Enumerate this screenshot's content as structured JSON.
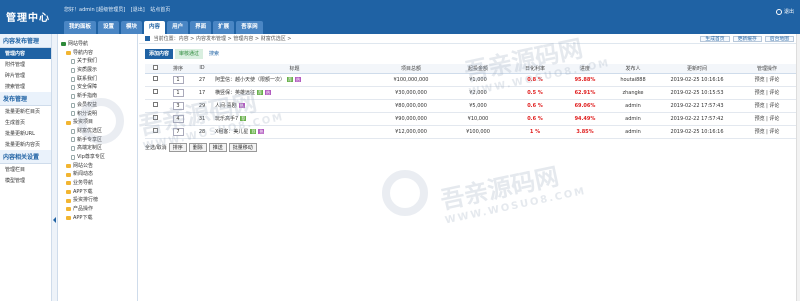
{
  "header": {
    "brand": "管理中心",
    "userbar": [
      "您好！admin [超级管理员]",
      "[退出]",
      "站点首页"
    ],
    "tabs": [
      "我的面板",
      "设置",
      "模块",
      "内容",
      "用户",
      "界面",
      "扩展",
      "吾享网"
    ],
    "active_tab": 3,
    "exit": "退出"
  },
  "left": {
    "sections": [
      {
        "title": "内容发布管理",
        "items": [
          "管理内容",
          "附件管理",
          "碎片管理",
          "搜索管理"
        ],
        "active": 0
      },
      {
        "title": "发布管理",
        "items": [
          "批量更新栏目页",
          "生成首页",
          "批量更新URL",
          "批量更新内容页"
        ]
      },
      {
        "title": "内容相关设置",
        "items": [
          "管理栏目",
          "模型管理"
        ]
      }
    ]
  },
  "tree": [
    {
      "label": "网站导航",
      "depth": 0,
      "icon": "check"
    },
    {
      "label": "导航内容",
      "depth": 1,
      "icon": "folder"
    },
    {
      "label": "关于我们",
      "depth": 2,
      "icon": "doc"
    },
    {
      "label": "资质展示",
      "depth": 2,
      "icon": "doc"
    },
    {
      "label": "联系我们",
      "depth": 2,
      "icon": "doc"
    },
    {
      "label": "安全保障",
      "depth": 2,
      "icon": "doc"
    },
    {
      "label": "新手指南",
      "depth": 2,
      "icon": "doc"
    },
    {
      "label": "会员权益",
      "depth": 2,
      "icon": "doc"
    },
    {
      "label": "积分说明",
      "depth": 2,
      "icon": "doc"
    },
    {
      "label": "投资项目",
      "depth": 1,
      "icon": "folder"
    },
    {
      "label": "财富优选区",
      "depth": 2,
      "icon": "doc"
    },
    {
      "label": "新手专享区",
      "depth": 2,
      "icon": "doc"
    },
    {
      "label": "高端定制区",
      "depth": 2,
      "icon": "doc"
    },
    {
      "label": "Vip尊享专区",
      "depth": 2,
      "icon": "doc"
    },
    {
      "label": "网站公告",
      "depth": 1,
      "icon": "folder"
    },
    {
      "label": "新闻动态",
      "depth": 1,
      "icon": "folder"
    },
    {
      "label": "业务导航",
      "depth": 1,
      "icon": "folder"
    },
    {
      "label": "APP下载",
      "depth": 1,
      "icon": "folder"
    },
    {
      "label": "投资排行榜",
      "depth": 1,
      "icon": "folder"
    },
    {
      "label": "产品操作",
      "depth": 1,
      "icon": "folder"
    },
    {
      "label": "APP下载",
      "depth": 1,
      "icon": "folder"
    }
  ],
  "main": {
    "breadcrumb": "当前位置：内容 > 内容发布管理 > 管理内容 > 财富优选区 >",
    "top_buttons": [
      "生成首页",
      "更新缓存",
      "后台地图"
    ],
    "tabs": [
      "添加内容",
      "审核通过",
      "搜索"
    ],
    "columns": [
      "",
      "排序",
      "ID",
      "标题",
      "项目总额",
      "起投金额",
      "日化利率",
      "进度",
      "发布人",
      "更新时间",
      "管理操作"
    ],
    "rows": [
      {
        "sort": "1",
        "id": "27",
        "title": "阿里信：越小天使（限额一次）",
        "tags": [
          "荐",
          "热"
        ],
        "total": "¥100,000,000",
        "min": "¥1,000",
        "rate": "0.8 %",
        "progress": "95.88%",
        "user": "houtai888",
        "time": "2019-02-25 10:16:16",
        "ops": "预览 | 评论"
      },
      {
        "sort": "1",
        "id": "17",
        "title": "横竖保：英雄远征",
        "tags": [
          "荐",
          "热"
        ],
        "total": "¥30,000,000",
        "min": "¥2,000",
        "rate": "0.5 %",
        "progress": "62.91%",
        "user": "zhangke",
        "time": "2019-02-25 10:15:53",
        "ops": "预览 | 评论"
      },
      {
        "sort": "3",
        "id": "29",
        "title": "人间·喜剧",
        "tags": [
          "热"
        ],
        "total": "¥80,000,000",
        "min": "¥5,000",
        "rate": "0.6 %",
        "progress": "69.06%",
        "user": "admin",
        "time": "2019-02-22 17:57:43",
        "ops": "预览 | 评论"
      },
      {
        "sort": "4",
        "id": "31",
        "title": "玩乐高手7",
        "tags": [
          "荐"
        ],
        "total": "¥90,000,000",
        "min": "¥10,000",
        "rate": "0.6 %",
        "progress": "94.49%",
        "user": "admin",
        "time": "2019-02-22 17:57:42",
        "ops": "预览 | 评论"
      },
      {
        "sort": "7",
        "id": "28",
        "title": "X租客：美儿星",
        "tags": [
          "荐",
          "热"
        ],
        "total": "¥12,000,000",
        "min": "¥100,000",
        "rate": "1 %",
        "progress": "3.85%",
        "user": "admin",
        "time": "2019-02-25 10:16:16",
        "ops": "预览 | 评论"
      }
    ],
    "bottom": {
      "select_all": "全选/取消",
      "buttons": [
        "排序",
        "删除",
        "推送",
        "批量移动"
      ]
    }
  },
  "watermark": {
    "main": "吾亲源码网",
    "sub": "WWW.WOSUO8.COM"
  }
}
